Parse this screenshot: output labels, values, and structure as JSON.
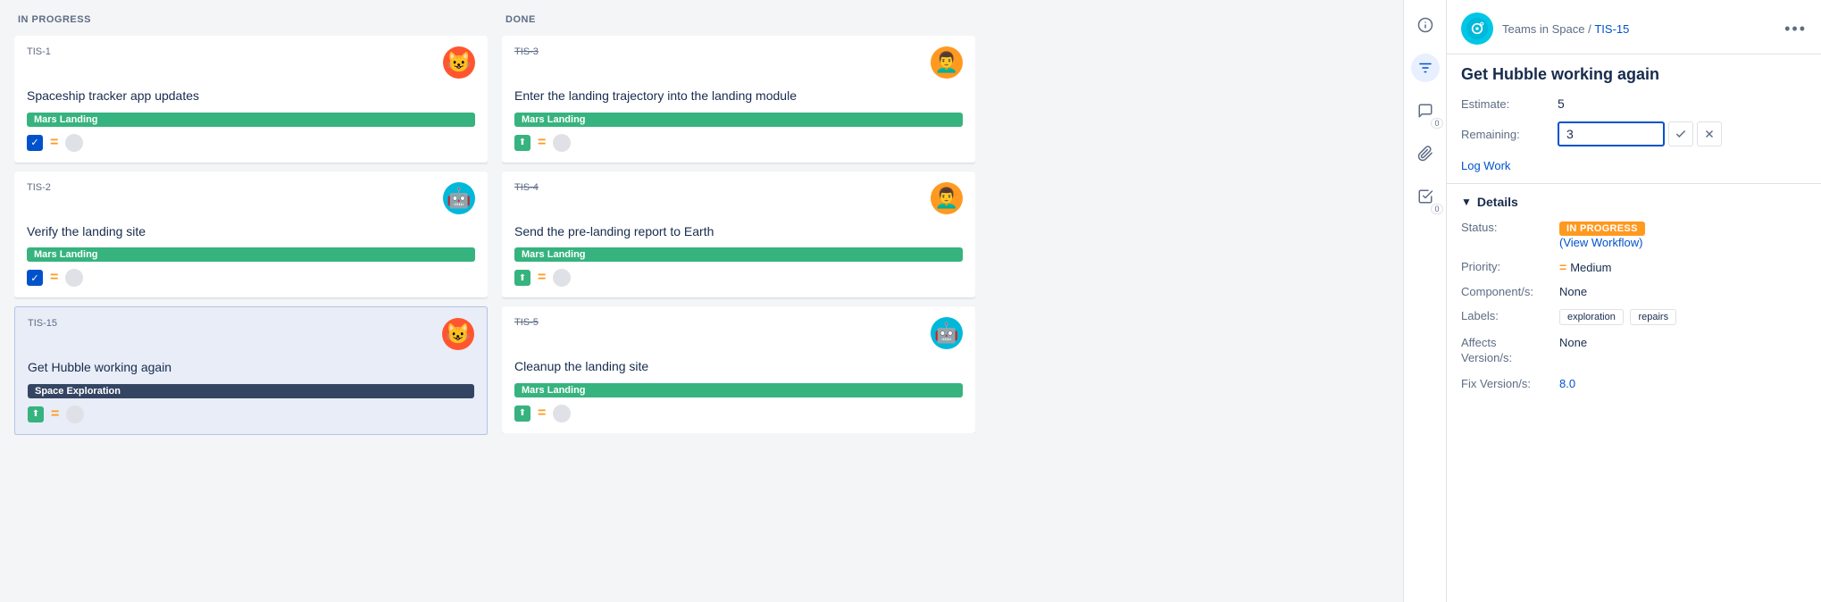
{
  "board": {
    "columns": [
      {
        "id": "in-progress",
        "label": "IN PROGRESS",
        "cards": [
          {
            "id": "TIS-1",
            "id_strikethrough": false,
            "title": "Spaceship tracker app updates",
            "tag": "Mars Landing",
            "tag_style": "green",
            "avatar_emoji": "😺",
            "avatar_color": "red",
            "footer_icon": "check",
            "selected": false
          },
          {
            "id": "TIS-2",
            "id_strikethrough": false,
            "title": "Verify the landing site",
            "tag": "Mars Landing",
            "tag_style": "green",
            "avatar_emoji": "🤖",
            "avatar_color": "teal",
            "footer_icon": "check",
            "selected": false
          },
          {
            "id": "TIS-15",
            "id_strikethrough": false,
            "title": "Get Hubble working again",
            "tag": "Space Exploration",
            "tag_style": "dark",
            "avatar_emoji": "😺",
            "avatar_color": "red",
            "footer_icon": "story",
            "selected": true
          }
        ]
      },
      {
        "id": "done",
        "label": "DONE",
        "cards": [
          {
            "id": "TIS-3",
            "id_strikethrough": true,
            "title": "Enter the landing trajectory into the landing module",
            "tag": "Mars Landing",
            "tag_style": "green",
            "avatar_emoji": "👨‍🦱",
            "avatar_color": "orange",
            "footer_icon": "story",
            "selected": false
          },
          {
            "id": "TIS-4",
            "id_strikethrough": true,
            "title": "Send the pre-landing report to Earth",
            "tag": "Mars Landing",
            "tag_style": "green",
            "avatar_emoji": "👨‍🦱",
            "avatar_color": "orange",
            "footer_icon": "story",
            "selected": false
          },
          {
            "id": "TIS-5",
            "id_strikethrough": true,
            "title": "Cleanup the landing site",
            "tag": "Mars Landing",
            "tag_style": "green",
            "avatar_emoji": "🤖",
            "avatar_color": "teal",
            "footer_icon": "story",
            "selected": false
          }
        ]
      }
    ]
  },
  "detail": {
    "breadcrumb_project": "Teams in Space",
    "breadcrumb_separator": "/",
    "breadcrumb_issue": "TIS-15",
    "title": "Get Hubble working again",
    "estimate_label": "Estimate:",
    "estimate_value": "5",
    "remaining_label": "Remaining:",
    "remaining_value": "3",
    "log_work_label": "Log Work",
    "details_section_label": "Details",
    "status_label": "Status:",
    "status_value": "IN PROGRESS",
    "view_workflow_label": "(View Workflow)",
    "priority_label": "Priority:",
    "priority_value": "Medium",
    "components_label": "Component/s:",
    "components_value": "None",
    "labels_label": "Labels:",
    "label1": "exploration",
    "label2": "repairs",
    "affects_label": "Affects\nVersion/s:",
    "affects_value": "None",
    "fix_version_label": "Fix Version/s:",
    "fix_version_value": "8.0",
    "more_icon": "•••"
  },
  "side_icons": {
    "info": "ℹ",
    "filter": "≡",
    "comment": "💬",
    "comment_count": "0",
    "attachment": "📎",
    "checklist": "☑",
    "checklist_count": "0"
  }
}
